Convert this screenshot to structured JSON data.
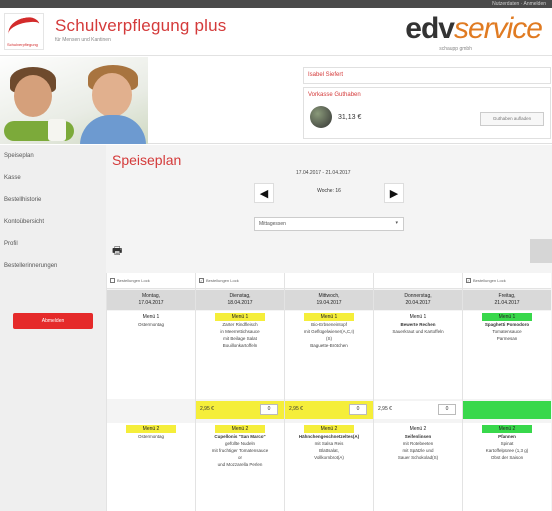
{
  "topbar": {
    "meta": "Nutzerdaten · Anmelden"
  },
  "header": {
    "logo_text": "Schulverpflegung",
    "title": "Schulverpflegung plus",
    "subtitle": "für Mensen und Kantinen",
    "brand_main": "edv",
    "brand_accent": "service",
    "brand_sub": "schaupp gmbh"
  },
  "user": {
    "name": "Isabel Siefert",
    "kasse_label": "Vorkasse Guthaben",
    "balance": "31,13 €",
    "aufladen_label": "Guthaben aufladen"
  },
  "sidebar": {
    "items": [
      "Speiseplan",
      "Kasse",
      "Bestellhistorie",
      "Kontoübersicht",
      "Profil",
      "Bestellerinnerungen"
    ],
    "logout": "Abmelden"
  },
  "main": {
    "title": "Speiseplan",
    "daterange": "17.04.2017 - 21.04.2017",
    "week": "Woche: 16",
    "select_value": "Mittagessen",
    "print_icon": "printer-icon"
  },
  "days": [
    {
      "check_label": "Bestellungen Lock",
      "checked": false,
      "name": "Montag,",
      "date": "17.04.2017",
      "m1_title": "Menü 1",
      "m1_lines": [
        "Ostermontag"
      ],
      "price": "",
      "qty": "",
      "bar": "none",
      "m2_title": "Menü 2",
      "m2_lines": [
        "Ostermontag"
      ]
    },
    {
      "check_label": "Bestellungen Lock",
      "checked": true,
      "name": "Dienstag,",
      "date": "18.04.2017",
      "m1_title": "Menü 1",
      "m1_lines": [
        "Zarter Rindfleisch",
        "in Meerrettichsauce",
        "mit Beilage Salat",
        "Bouillonkartoffeln"
      ],
      "price": "2,95 €",
      "qty": "0",
      "bar": "yellow",
      "m2_title": "Menü 2",
      "m2_lines": [
        "Cupellonis \"San Marco\"",
        "gefüllte Nudeln",
        "mit fruchtiger Tomatensauce",
        "or",
        "und Mozzarella Perlen"
      ]
    },
    {
      "check_label": "",
      "checked": false,
      "name": "Mittwoch,",
      "date": "19.04.2017",
      "m1_title": "Menü 1",
      "m1_lines": [
        "Bio-Erbseneintopf",
        "mit Geflügelwiener(A,C,I)",
        "(S)",
        "Baguette-Brötchen"
      ],
      "price": "2,95 €",
      "qty": "0",
      "bar": "yellow",
      "m2_title": "Menü 2",
      "m2_lines": [
        "Hähnchengeschnetzeltes(A)",
        "mit Salsa Reis",
        "Blattsalat,",
        "Vollkornbrot(A)"
      ]
    },
    {
      "check_label": "",
      "checked": false,
      "name": "Donnerstag,",
      "date": "20.04.2017",
      "m1_title": "Menü 1",
      "m1_lines": [
        "Bewerte Rechen",
        "Sauerkraut und Kartoffeln"
      ],
      "price": "2,95 €",
      "qty": "0",
      "bar": "white",
      "m2_title": "Menü 2",
      "m2_lines": [
        "Seifenlinsen",
        "mit Rotebeeten",
        "mit Spätzle und",
        "Sauer Schokolad(S)"
      ]
    },
    {
      "check_label": "Bestellungen Lock",
      "checked": true,
      "name": "Freitag,",
      "date": "21.04.2017",
      "m1_title": "Menü 1",
      "m1_lines": [
        "Spaghetti Pomodoro",
        "Tomatensauce",
        "Parmesan"
      ],
      "price": "",
      "qty": "",
      "bar": "green",
      "m2_title": "Menü 2",
      "m2_lines": [
        "Pfannen",
        "Spinat",
        "Kartoffelpüree (1,3 g)",
        "Obst der Saison"
      ]
    }
  ],
  "colors": {
    "accent": "#d43a3a",
    "yellow": "#f5ee3a",
    "green": "#38d84b"
  }
}
